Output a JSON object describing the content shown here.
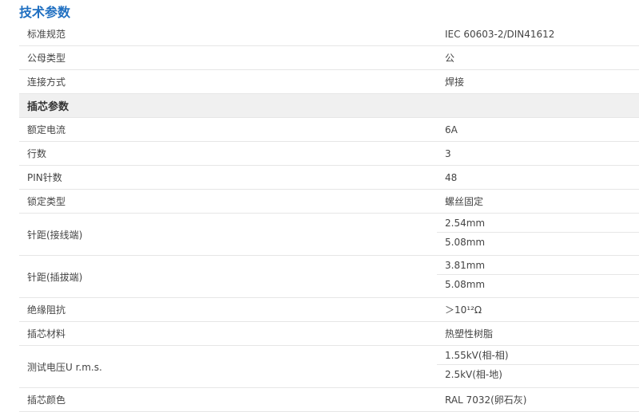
{
  "title": "技术参数",
  "rows_top": [
    {
      "label": "标准规范",
      "value": "IEC 60603-2/DIN41612"
    },
    {
      "label": "公母类型",
      "value": "公"
    },
    {
      "label": "连接方式",
      "value": "焊接"
    }
  ],
  "section": "插芯参数",
  "rows": [
    {
      "label": "额定电流",
      "value": "6A"
    },
    {
      "label": "行数",
      "value": "3"
    },
    {
      "label": "PIN针数",
      "value": "48"
    },
    {
      "label": "锁定类型",
      "value": "螺丝固定"
    },
    {
      "label": "针距(接线端)",
      "values": [
        "2.54mm",
        "5.08mm"
      ]
    },
    {
      "label": "针距(插拔端)",
      "values": [
        "3.81mm",
        "5.08mm"
      ]
    },
    {
      "label": "绝缘阻抗",
      "value": "＞10¹²Ω"
    },
    {
      "label": "插芯材料",
      "value": "热塑性树脂"
    },
    {
      "label": "测试电压U r.m.s.",
      "values": [
        "1.55kV(相-相)",
        "2.5kV(相-地)"
      ]
    },
    {
      "label": "插芯颜色",
      "value": "RAL 7032(卵石灰)"
    }
  ]
}
